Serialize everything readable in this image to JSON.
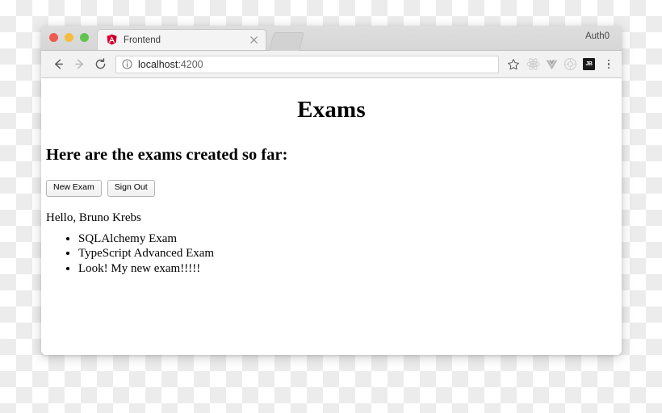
{
  "window": {
    "app_title": "Auth0",
    "traffic_lights": [
      "close-button",
      "minimize-button",
      "maximize-button"
    ]
  },
  "tab_strip": {
    "tabs": [
      {
        "title": "Frontend",
        "favicon": "angular-icon",
        "close": "close-icon"
      }
    ],
    "new_tab_label": "+"
  },
  "toolbar": {
    "back": "back-arrow-icon",
    "forward": "forward-arrow-icon",
    "reload": "reload-icon",
    "site_info": "info-circle-icon",
    "url_host": "localhost",
    "url_port": ":4200",
    "bookmark": "star-icon",
    "extensions": [
      {
        "name": "react-devtools-icon",
        "label": ""
      },
      {
        "name": "vue-devtools-icon",
        "label": "V"
      },
      {
        "name": "unknown-extension-icon",
        "label": ""
      },
      {
        "name": "jetbrains-ide-icon",
        "label": "JB"
      }
    ],
    "menu": "three-dot-menu-icon"
  },
  "page": {
    "title": "Exams",
    "subtitle": "Here are the exams created so far:",
    "buttons": {
      "new_exam": "New Exam",
      "sign_out": "Sign Out"
    },
    "greeting": "Hello, Bruno Krebs",
    "exams": [
      "SQLAlchemy Exam",
      "TypeScript Advanced Exam",
      "Look! My new exam!!!!!"
    ]
  },
  "colors": {
    "angular_red": "#dd0031",
    "traffic_red": "#f0594f",
    "traffic_yellow": "#f6bc3d",
    "traffic_green": "#5fc54d",
    "jetbrains_black": "#1a1a1a"
  }
}
